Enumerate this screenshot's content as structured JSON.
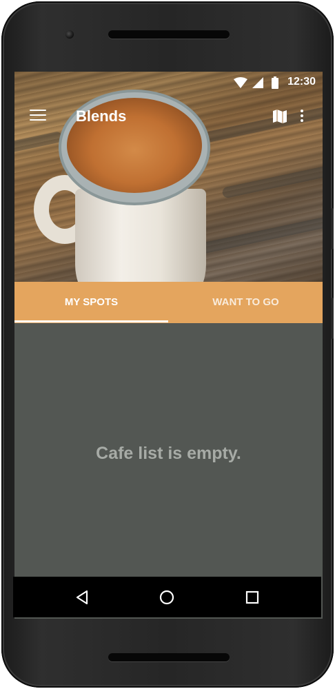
{
  "status_bar": {
    "time": "12:30",
    "icons": [
      "wifi-icon",
      "signal-icon",
      "battery-icon"
    ]
  },
  "app_bar": {
    "title": "Blends",
    "icons": [
      "menu-icon",
      "map-icon",
      "more-vert-icon"
    ]
  },
  "tabs": [
    {
      "label": "MY SPOTS",
      "selected": true
    },
    {
      "label": "WANT TO GO",
      "selected": false
    }
  ],
  "content": {
    "empty_message": "Cafe list is empty."
  },
  "nav_bar": {
    "buttons": [
      "back-icon",
      "home-icon",
      "recents-icon"
    ]
  },
  "colors": {
    "accent": "#e4a55e",
    "content_background": "#535753",
    "empty_text": "#a7aba6"
  }
}
